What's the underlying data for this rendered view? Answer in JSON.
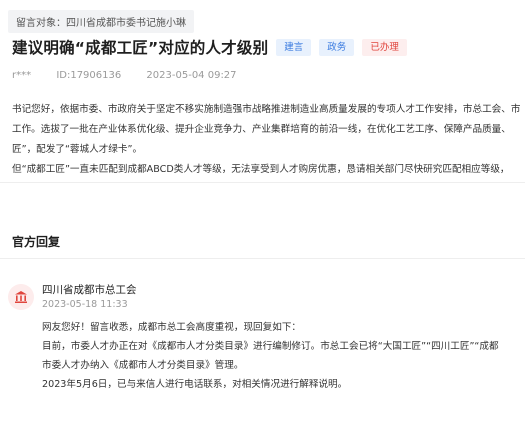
{
  "message": {
    "target_label": "留言对象：",
    "target_value": "四川省成都市委书记施小琳",
    "title": "建议明确“成都工匠”对应的人才级别",
    "tags": [
      {
        "label": "建言",
        "color": "#3a7be0"
      },
      {
        "label": "政务",
        "color": "#3a7be0"
      },
      {
        "label": "已办理",
        "color": "#e0453d"
      }
    ],
    "author": "r***",
    "id": "ID:17906136",
    "datetime": "2023-05-04 09:27",
    "body_lines": [
      "书记您好，依据市委、市政府关于坚定不移实施制造强市战略推进制造业高质量发展的专项人才工作安排，市总工会、市",
      "工作。选拔了一批在产业体系优化级、提升企业竞争力、产业集群培育的前沿一线，在优化工艺工序、保障产品质量、",
      "匠”，配发了“蓉城人才绿卡”。",
      "但“成都工匠”一直未匹配到成都ABCD类人才等级，无法享受到人才购房优惠，恳请相关部门尽快研究匹配相应等级，"
    ]
  },
  "reply": {
    "section_title": "官方回复",
    "org_name": "四川省成都市总工会",
    "org_icon": "government-building-icon",
    "datetime": "2023-05-18 11:33",
    "lines": [
      "网友您好！留言收悉，成都市总工会高度重视，现回复如下：",
      "目前，市委人才办正在对《成都市人才分类目录》进行编制修订。市总工会已将“大国工匠”“四川工匠”“成都",
      "市委人才办纳入《成都市人才分类目录》管理。",
      "2023年5月6日，已与来信人进行电话联系，对相关情况进行解释说明。"
    ]
  }
}
